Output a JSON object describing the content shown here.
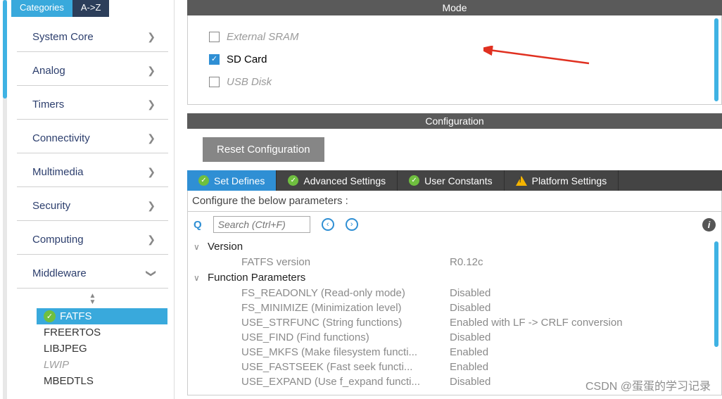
{
  "sidebar": {
    "tabs": {
      "categories": "Categories",
      "az": "A->Z"
    },
    "items": [
      {
        "label": "System Core"
      },
      {
        "label": "Analog"
      },
      {
        "label": "Timers"
      },
      {
        "label": "Connectivity"
      },
      {
        "label": "Multimedia"
      },
      {
        "label": "Security"
      },
      {
        "label": "Computing"
      },
      {
        "label": "Middleware"
      }
    ],
    "middleware": {
      "items": [
        {
          "label": "FATFS",
          "selected": true
        },
        {
          "label": "FREERTOS"
        },
        {
          "label": "LIBJPEG"
        },
        {
          "label": "LWIP",
          "disabled": true
        },
        {
          "label": "MBEDTLS"
        }
      ]
    }
  },
  "mode": {
    "title": "Mode",
    "options": [
      {
        "label": "External SRAM",
        "checked": false,
        "disabled": true
      },
      {
        "label": "SD Card",
        "checked": true,
        "disabled": false
      },
      {
        "label": "USB Disk",
        "checked": false,
        "disabled": true
      }
    ]
  },
  "config": {
    "title": "Configuration",
    "reset_label": "Reset Configuration",
    "tabs": [
      {
        "label": "Set Defines",
        "icon": "ok",
        "active": true
      },
      {
        "label": "Advanced Settings",
        "icon": "ok"
      },
      {
        "label": "User Constants",
        "icon": "ok"
      },
      {
        "label": "Platform Settings",
        "icon": "warn"
      }
    ],
    "prompt": "Configure the below parameters :",
    "search_placeholder": "Search (Ctrl+F)",
    "groups": [
      {
        "name": "Version",
        "rows": [
          {
            "label": "FATFS version",
            "value": "R0.12c"
          }
        ]
      },
      {
        "name": "Function Parameters",
        "rows": [
          {
            "label": "FS_READONLY (Read-only mode)",
            "value": "Disabled"
          },
          {
            "label": "FS_MINIMIZE (Minimization level)",
            "value": "Disabled"
          },
          {
            "label": "USE_STRFUNC (String functions)",
            "value": "Enabled with LF -> CRLF conversion"
          },
          {
            "label": "USE_FIND (Find functions)",
            "value": "Disabled"
          },
          {
            "label": "USE_MKFS (Make filesystem functi...",
            "value": "Enabled"
          },
          {
            "label": "USE_FASTSEEK (Fast seek functi...",
            "value": "Enabled"
          },
          {
            "label": "USE_EXPAND (Use f_expand functi...",
            "value": "Disabled"
          }
        ]
      }
    ]
  },
  "watermark": "CSDN @蛋蛋的学习记录"
}
